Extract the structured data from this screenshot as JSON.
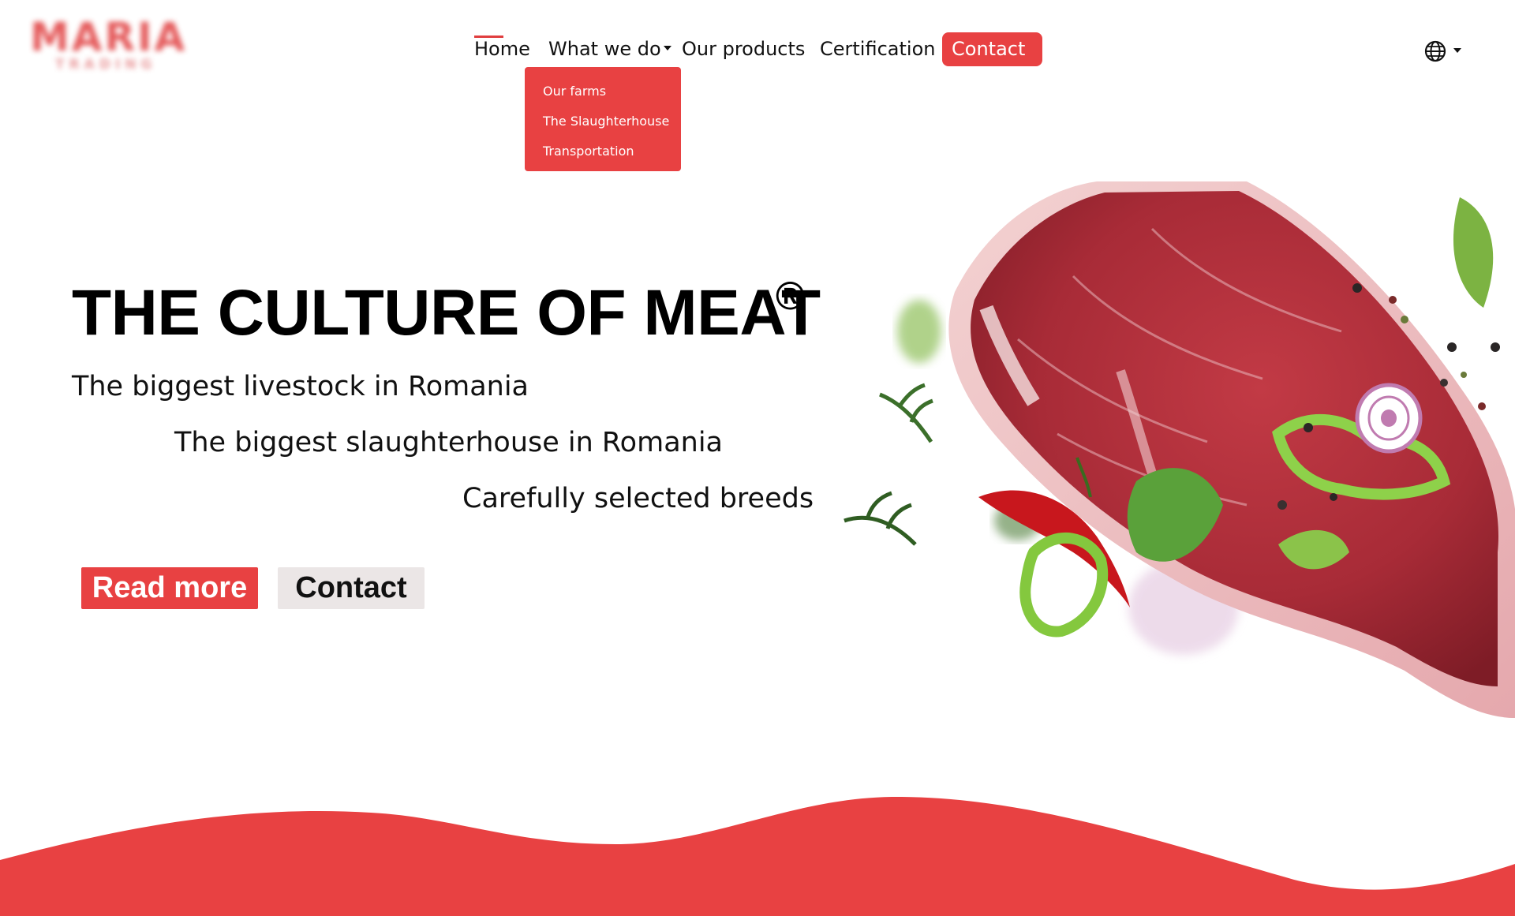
{
  "logo": {
    "text": "MARIA",
    "subtext": "TRADING"
  },
  "nav": {
    "home": "Home",
    "what_we_do": "What we do",
    "products": "Our products",
    "certification": "Certification",
    "contact": "Contact"
  },
  "dropdown": {
    "items": [
      {
        "label": "Our farms"
      },
      {
        "label": "The Slaughterhouse"
      },
      {
        "label": "Transportation"
      }
    ]
  },
  "language": {
    "icon": "globe-icon"
  },
  "hero": {
    "title": "THE CULTURE OF MEAT",
    "registered_mark": "®",
    "lines": [
      "The biggest livestock in Romania",
      "The biggest slaughterhouse in Romania",
      "Carefully selected breeds"
    ],
    "read_more": "Read more",
    "contact": "Contact"
  },
  "colors": {
    "accent": "#e84142",
    "secondary_button": "#ebe6e6",
    "text": "#111111",
    "meat": "#b0303c"
  }
}
